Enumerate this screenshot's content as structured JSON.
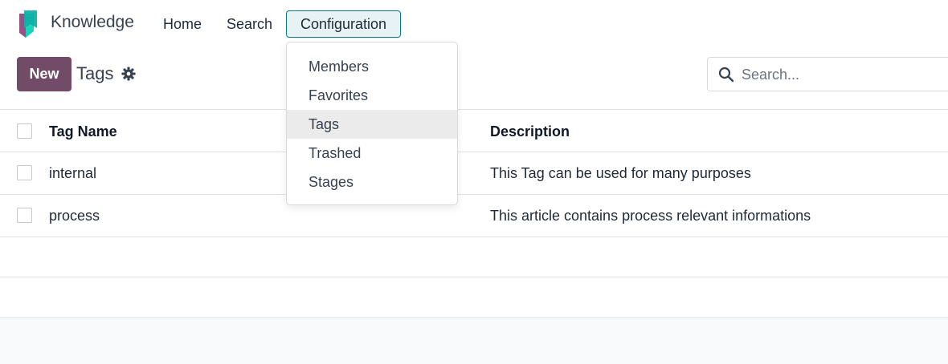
{
  "app": {
    "name": "Knowledge",
    "logo_icon": "knowledge-bookmark-logo",
    "colors": {
      "logo_teal": "#1ad3bb",
      "logo_dark_teal": "#017e84",
      "logo_purple": "#985184",
      "brand": "#714b67",
      "accent": "#017e84"
    }
  },
  "nav": {
    "home": "Home",
    "search": "Search",
    "configuration": "Configuration"
  },
  "control_panel": {
    "new_label": "New",
    "title": "Tags",
    "settings_icon": "gear-icon",
    "search_placeholder": "Search..."
  },
  "table": {
    "columns": [
      "Tag Name",
      "Description"
    ],
    "rows": [
      {
        "name": "internal",
        "description": "This Tag can be used for many purposes"
      },
      {
        "name": "process",
        "description": "This article contains process relevant informations"
      }
    ]
  },
  "config_menu": {
    "items": [
      {
        "label": "Members",
        "active": false
      },
      {
        "label": "Favorites",
        "active": false
      },
      {
        "label": "Tags",
        "active": true
      },
      {
        "label": "Trashed",
        "active": false
      },
      {
        "label": "Stages",
        "active": false
      }
    ]
  }
}
